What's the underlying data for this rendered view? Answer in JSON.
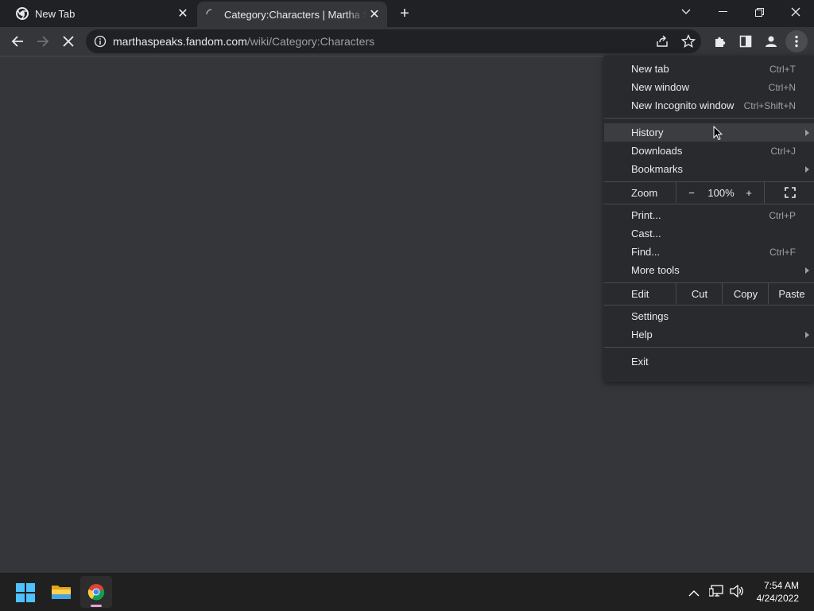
{
  "tabs": [
    {
      "title": "New Tab",
      "close_label": "✕"
    },
    {
      "title": "Category:Characters | Martha Speaks Wiki | Fandom",
      "close_label": "✕"
    }
  ],
  "new_tab_label": "+",
  "address": {
    "host": "marthaspeaks.fandom.com",
    "path": "/wiki/Category:Characters"
  },
  "menu": {
    "new_tab": {
      "label": "New tab",
      "shortcut": "Ctrl+T"
    },
    "new_window": {
      "label": "New window",
      "shortcut": "Ctrl+N"
    },
    "incognito": {
      "label": "New Incognito window",
      "shortcut": "Ctrl+Shift+N"
    },
    "history": {
      "label": "History"
    },
    "downloads": {
      "label": "Downloads",
      "shortcut": "Ctrl+J"
    },
    "bookmarks": {
      "label": "Bookmarks"
    },
    "zoom": {
      "label": "Zoom",
      "minus": "−",
      "value": "100%",
      "plus": "+"
    },
    "print": {
      "label": "Print...",
      "shortcut": "Ctrl+P"
    },
    "cast": {
      "label": "Cast..."
    },
    "find": {
      "label": "Find...",
      "shortcut": "Ctrl+F"
    },
    "more_tools": {
      "label": "More tools"
    },
    "edit": {
      "label": "Edit",
      "cut": "Cut",
      "copy": "Copy",
      "paste": "Paste"
    },
    "settings": {
      "label": "Settings"
    },
    "help": {
      "label": "Help"
    },
    "exit": {
      "label": "Exit"
    }
  },
  "clock": {
    "time": "7:54 AM",
    "date": "4/24/2022"
  },
  "colors": {
    "accent": "#8ab4f8",
    "menu_bg": "#292a2d",
    "page_bg": "#35363a",
    "tab_strip": "#202124"
  }
}
